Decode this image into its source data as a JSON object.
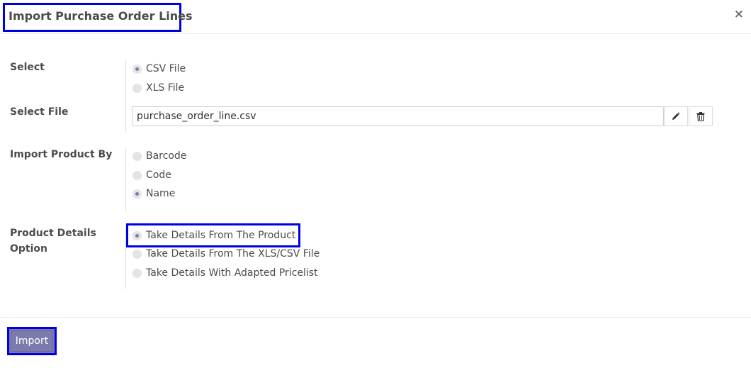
{
  "dialog": {
    "title": "Import Purchase Order Lines",
    "close_label": "×"
  },
  "select": {
    "label": "Select",
    "options": [
      {
        "label": "CSV File",
        "checked": true
      },
      {
        "label": "XLS File",
        "checked": false
      }
    ]
  },
  "select_file": {
    "label": "Select File",
    "value": "purchase_order_line.csv",
    "edit_icon": "pencil-icon",
    "delete_icon": "trash-icon"
  },
  "import_product_by": {
    "label": "Import Product By",
    "options": [
      {
        "label": "Barcode",
        "checked": false
      },
      {
        "label": "Code",
        "checked": false
      },
      {
        "label": "Name",
        "checked": true
      }
    ]
  },
  "product_details": {
    "label_line1": "Product Details",
    "label_line2": "Option",
    "options": [
      {
        "label": "Take Details From The Product",
        "checked": true
      },
      {
        "label": "Take Details From The XLS/CSV File",
        "checked": false
      },
      {
        "label": "Take Details With Adapted Pricelist",
        "checked": false
      }
    ]
  },
  "footer": {
    "import_label": "Import"
  },
  "colors": {
    "highlight": "#0000e6",
    "primary": "#7c7bad"
  }
}
